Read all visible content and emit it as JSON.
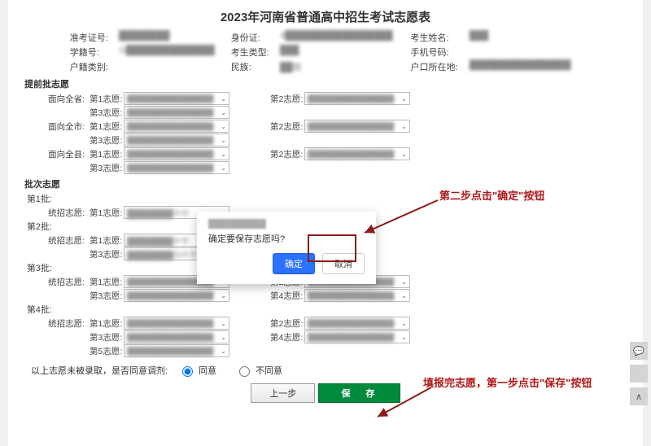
{
  "title": "2023年河南省普通高中招生考试志愿表",
  "info": {
    "exam_id_label": "准考证号:",
    "id_card_label": "身份证:",
    "name_label": "考生姓名:",
    "student_code_label": "学籍号:",
    "type_label": "考生类型:",
    "phone_label": "手机号码:",
    "hukou_cat_label": "户籍类别:",
    "nation_label": "民族:",
    "hukou_loc_label": "户口所在地:",
    "exam_id": "████████",
    "id_card": "4█████████████████",
    "name": "███",
    "student_code": "G██████████████",
    "type": "███",
    "phone": "",
    "hukou_cat": "",
    "nation": "██族",
    "hukou_loc": "████████████████"
  },
  "sections": {
    "pre": "提前批志愿",
    "batch": "批次志愿"
  },
  "pre_scopes": [
    "面向全省:",
    "面向全市:",
    "面向全县:"
  ],
  "choice_labels": {
    "c1": "第1志愿:",
    "c2": "第2志愿:",
    "c3": "第3志愿:",
    "c4": "第4志愿:",
    "c5": "第5志愿:"
  },
  "batch_labels": {
    "b1": "第1批:",
    "b2": "第2批:",
    "b3": "第3批:",
    "b4": "第4批:"
  },
  "track_label": "统招志愿:",
  "consent": {
    "question": "以上志愿未被录取，是否同意调剂:",
    "agree": "同意",
    "disagree": "不同意"
  },
  "buttons": {
    "prev": "上一步",
    "save": "保 存"
  },
  "modal": {
    "host": "██████████",
    "msg": "确定要保存志愿吗?",
    "ok": "确定",
    "cancel": "取消"
  },
  "anno": {
    "step2": "第二步点击\"确定\"按钮",
    "step1": "填报完志愿，第一步点击\"保存\"按钮"
  },
  "blur_school_a": "████████中学",
  "blur_school_b": "████████验中学",
  "blur_generic": "███████████████",
  "caret": "⌄"
}
